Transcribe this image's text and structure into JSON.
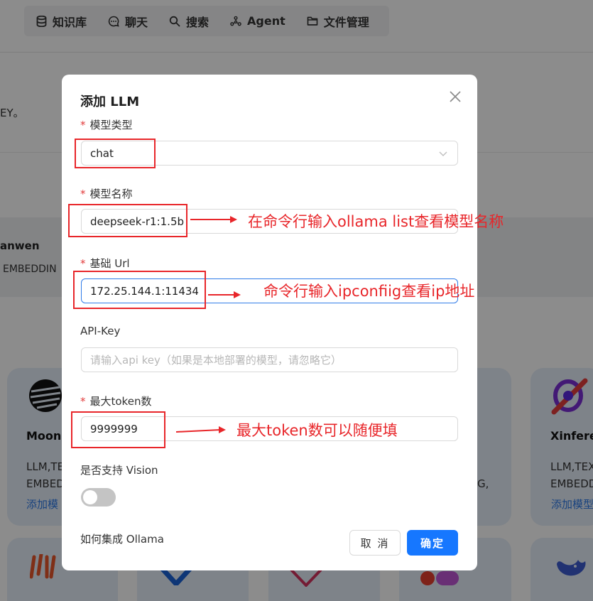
{
  "nav": {
    "items": [
      {
        "label": "知识库",
        "icon": "database-icon"
      },
      {
        "label": "聊天",
        "icon": "chat-bubble-icon"
      },
      {
        "label": "搜索",
        "icon": "search-icon"
      },
      {
        "label": "Agent",
        "icon": "graph-nodes-icon"
      },
      {
        "label": "文件管理",
        "icon": "folder-icon"
      }
    ]
  },
  "background": {
    "key_text": "EY。",
    "band_title": "anwen",
    "band_sub": "EMBEDDIN",
    "cards": [
      {
        "title": "Moons",
        "line1": "LLM,TE",
        "line2": "EMBED",
        "link": "添加模"
      },
      {
        "line2": "G,"
      },
      {
        "title": "Xinferen",
        "line1": "LLM,TEX",
        "line2": "EMBEDD",
        "link": "添加模型"
      }
    ]
  },
  "modal": {
    "title": "添加 LLM",
    "model_type": {
      "label": "模型类型",
      "value": "chat"
    },
    "model_name": {
      "label": "模型名称",
      "value": "deepseek-r1:1.5b"
    },
    "base_url": {
      "label": "基础 Url",
      "value": "172.25.144.1:11434"
    },
    "api_key": {
      "label": "API-Key",
      "placeholder": "请输入api key（如果是本地部署的模型，请忽略它）"
    },
    "max_tokens": {
      "label": "最大token数",
      "value": "9999999"
    },
    "vision": {
      "label": "是否支持 Vision",
      "enabled": false
    },
    "help_link": "如何集成 Ollama",
    "cancel_label": "取 消",
    "ok_label": "确定"
  },
  "annotations": {
    "model_name": "在命令行输入ollama list查看模型名称",
    "base_url": "命令行输入ipconfiig查看ip地址",
    "max_tokens": "最大token数可以随便填",
    "color": "#e8262a"
  },
  "colors": {
    "primary": "#1677ff",
    "required_star": "#e23b3b",
    "card_bg": "#e6eef9"
  }
}
